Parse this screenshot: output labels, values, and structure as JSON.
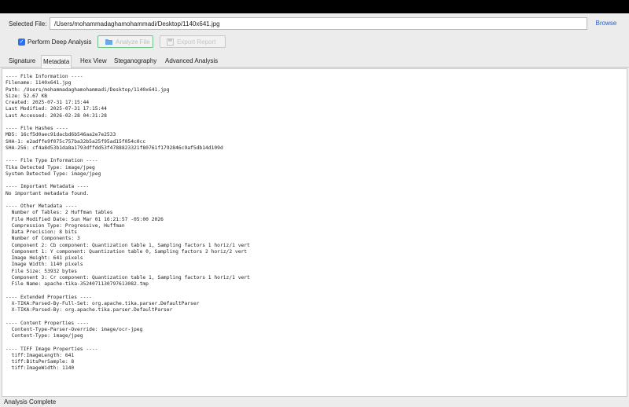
{
  "toolbar": {
    "selected_file_label": "Selected File:",
    "file_path_value": "/Users/mohammadaghamohammadi/Desktop/1140x641.jpg",
    "browse_label": "Browse",
    "deep_analysis_label": "Perform Deep Analysis",
    "deep_analysis_checked": true,
    "analyze_label": "Analyze File",
    "export_label": "Export Report"
  },
  "tabs": [
    {
      "label": "Signature"
    },
    {
      "label": "Metadata",
      "active": true
    },
    {
      "label": "Hex View"
    },
    {
      "label": "Steganography"
    },
    {
      "label": "Advanced Analysis"
    }
  ],
  "report": [
    "---- File Information ----",
    "Filename: 1140x641.jpg",
    "Path: /Users/mohammadaghamohammadi/Desktop/1140x641.jpg",
    "Size: 52.67 KB",
    "Created: 2025-07-31 17:15:44",
    "Last Modified: 2025-07-31 17:15:44",
    "Last Accessed: 2026-02-28 04:31:28",
    "",
    "---- File Hashes ----",
    "MD5: 16cf5d0aec91dacbd6b546aa2e7e2533",
    "SHA-1: e2adffe9f075c757ba32b5a25f95ad15f054c0cc",
    "SHA-256: cf4a8d53b1da8a1793dffdd53f4788823321f80761f1792846c9af5db14d109d",
    "",
    "---- File Type Information ----",
    "Tika Detected Type: image/jpeg",
    "System Detected Type: image/jpeg",
    "",
    "---- Important Metadata ----",
    "No important metadata found.",
    "",
    "---- Other Metadata ----",
    "  Number of Tables: 2 Huffman tables",
    "  File Modified Date: Sun Mar 01 16:21:57 -05:00 2026",
    "  Compression Type: Progressive, Huffman",
    "  Data Precision: 8 bits",
    "  Number of Components: 3",
    "  Component 2: Cb component: Quantization table 1, Sampling factors 1 horiz/1 vert",
    "  Component 1: Y component: Quantization table 0, Sampling factors 2 horiz/2 vert",
    "  Image Height: 641 pixels",
    "  Image Width: 1140 pixels",
    "  File Size: 53932 bytes",
    "  Component 3: Cr component: Quantization table 1, Sampling factors 1 horiz/1 vert",
    "  File Name: apache-tika-3524071130797613082.tmp",
    "",
    "---- Extended Properties ----",
    "  X-TIKA:Parsed-By-Full-Set: org.apache.tika.parser.DefaultParser",
    "  X-TIKA:Parsed-By: org.apache.tika.parser.DefaultParser",
    "",
    "---- Content Properties ----",
    "  Content-Type-Parser-Override: image/ocr-jpeg",
    "  Content-Type: image/jpeg",
    "",
    "---- TIFF Image Properties ----",
    "  tiff:ImageLength: 641",
    "  tiff:BitsPerSample: 8",
    "  tiff:ImageWidth: 1140"
  ],
  "status": {
    "text": "Analysis Complete"
  },
  "colors": {
    "accent": "#2a6ff0",
    "link": "#1a5fd1",
    "analyze_border": "#6fc481",
    "title_bar": "#000000"
  }
}
